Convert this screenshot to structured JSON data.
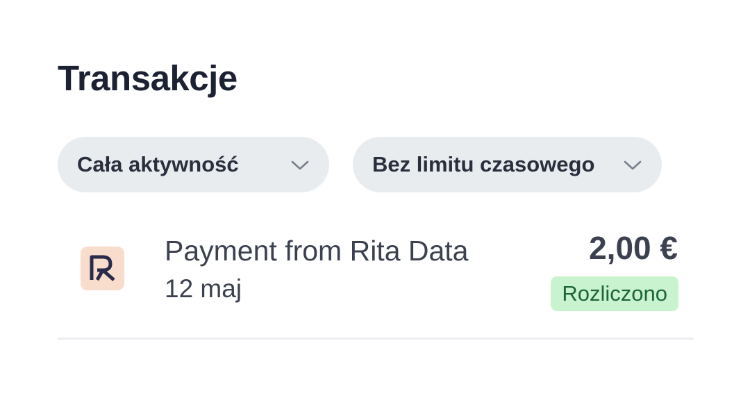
{
  "header": {
    "title": "Transakcje"
  },
  "filters": {
    "activity": {
      "label": "Cała aktywność",
      "icon": "chevron-down-icon"
    },
    "time": {
      "label": "Bez limitu czasowego",
      "icon": "chevron-down-icon"
    }
  },
  "transactions": [
    {
      "logo_icon": "merchant-logo-icon",
      "name": "Payment from Rita Data",
      "date": "12 maj",
      "amount": "2,00 €",
      "status": "Rozliczono"
    }
  ],
  "colors": {
    "title": "#1c2133",
    "pill_bg": "#e9ecef",
    "logo_bg": "#f8dccc",
    "logo_fg": "#2a2b4a",
    "badge_bg": "#c9f3ce",
    "badge_text": "#1d6634",
    "divider": "#ebedf0"
  }
}
